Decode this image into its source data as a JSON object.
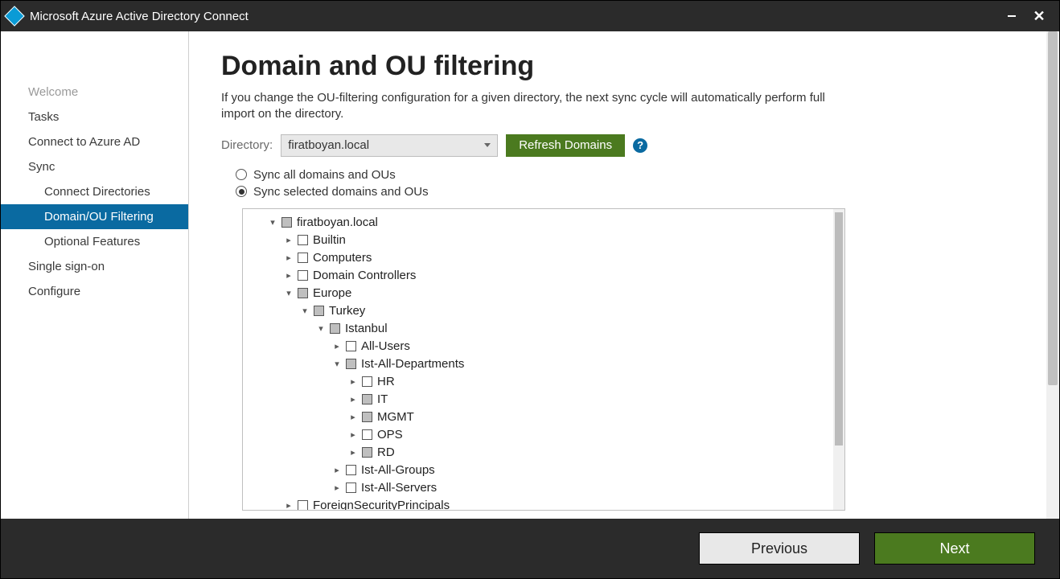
{
  "titlebar": {
    "title": "Microsoft Azure Active Directory Connect"
  },
  "sidebar": [
    {
      "label": "Welcome",
      "cls": "top dim"
    },
    {
      "label": "Tasks",
      "cls": "top"
    },
    {
      "label": "Connect to Azure AD",
      "cls": "top"
    },
    {
      "label": "Sync",
      "cls": "top"
    },
    {
      "label": "Connect Directories",
      "cls": "sub"
    },
    {
      "label": "Domain/OU Filtering",
      "cls": "sub selected"
    },
    {
      "label": "Optional Features",
      "cls": "sub"
    },
    {
      "label": "Single sign-on",
      "cls": "top"
    },
    {
      "label": "Configure",
      "cls": "top"
    }
  ],
  "main": {
    "title": "Domain and OU filtering",
    "description": "If you change the OU-filtering configuration for a given directory, the next sync cycle will automatically perform full import on the directory.",
    "directory_label": "Directory:",
    "directory_value": "firatboyan.local",
    "refresh_label": "Refresh Domains",
    "help_char": "?",
    "radio_all": "Sync all domains and OUs",
    "radio_sel": "Sync selected domains and OUs",
    "selected_option": "selected"
  },
  "tree": [
    {
      "label": "firatboyan.local",
      "indent": 0,
      "exp": "▾",
      "chk": "tri"
    },
    {
      "label": "Builtin",
      "indent": 1,
      "exp": "▸",
      "chk": ""
    },
    {
      "label": "Computers",
      "indent": 1,
      "exp": "▸",
      "chk": ""
    },
    {
      "label": "Domain Controllers",
      "indent": 1,
      "exp": "▸",
      "chk": ""
    },
    {
      "label": "Europe",
      "indent": 1,
      "exp": "▾",
      "chk": "tri"
    },
    {
      "label": "Turkey",
      "indent": 2,
      "exp": "▾",
      "chk": "tri"
    },
    {
      "label": "Istanbul",
      "indent": 3,
      "exp": "▾",
      "chk": "tri"
    },
    {
      "label": "All-Users",
      "indent": 4,
      "exp": "▸",
      "chk": ""
    },
    {
      "label": "Ist-All-Departments",
      "indent": 4,
      "exp": "▾",
      "chk": "tri"
    },
    {
      "label": "HR",
      "indent": 5,
      "exp": "▸",
      "chk": ""
    },
    {
      "label": "IT",
      "indent": 5,
      "exp": "▸",
      "chk": "tri"
    },
    {
      "label": "MGMT",
      "indent": 5,
      "exp": "▸",
      "chk": "tri"
    },
    {
      "label": "OPS",
      "indent": 5,
      "exp": "▸",
      "chk": ""
    },
    {
      "label": "RD",
      "indent": 5,
      "exp": "▸",
      "chk": "tri"
    },
    {
      "label": "Ist-All-Groups",
      "indent": 4,
      "exp": "▸",
      "chk": ""
    },
    {
      "label": "Ist-All-Servers",
      "indent": 4,
      "exp": "▸",
      "chk": ""
    },
    {
      "label": "ForeignSecurityPrincipals",
      "indent": 1,
      "exp": "▸",
      "chk": ""
    }
  ],
  "footer": {
    "previous": "Previous",
    "next": "Next"
  }
}
